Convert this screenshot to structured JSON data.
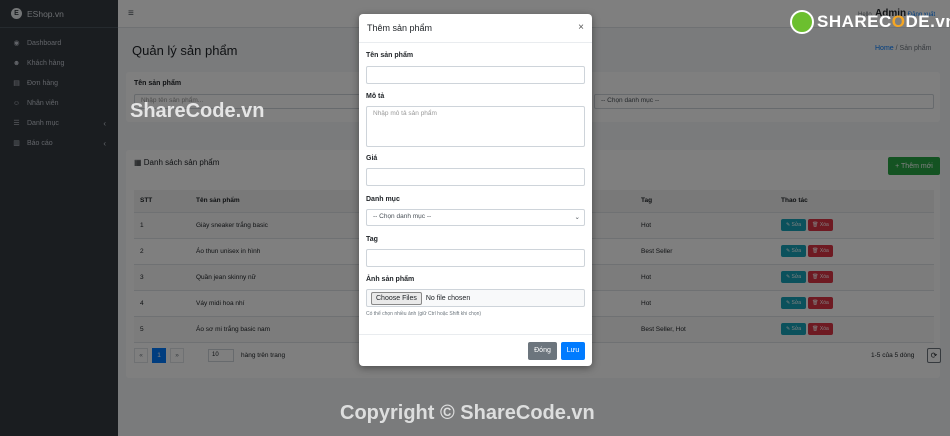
{
  "app": {
    "brand": "EShop.vn",
    "brand_logo": "E"
  },
  "sidebar": {
    "items": [
      {
        "label": "Dashboard",
        "icon": "dashboard-icon",
        "glyph": "◉",
        "chevron": ""
      },
      {
        "label": "Khách hàng",
        "icon": "users-icon",
        "glyph": "☻",
        "chevron": ""
      },
      {
        "label": "Đơn hàng",
        "icon": "file-icon",
        "glyph": "▤",
        "chevron": ""
      },
      {
        "label": "Nhân viên",
        "icon": "user-icon",
        "glyph": "☺",
        "chevron": ""
      },
      {
        "label": "Danh mục",
        "icon": "list-icon",
        "glyph": "☰",
        "chevron": "‹"
      },
      {
        "label": "Báo cáo",
        "icon": "chart-icon",
        "glyph": "▥",
        "chevron": "‹"
      }
    ]
  },
  "topbar": {
    "burger": "≡",
    "greeting": "Hello,",
    "user": "Admin",
    "logout": "Đăng xuất"
  },
  "page": {
    "title": "Quản lý sản phẩm",
    "breadcrumb_home": "Home",
    "breadcrumb_sep": "/",
    "breadcrumb_current": "Sản phẩm"
  },
  "filter": {
    "name_label": "Tên sản phẩm",
    "name_placeholder": "Nhập tên sản phẩm...",
    "category_value": "-- Chọn danh mục --"
  },
  "list": {
    "heading": "Danh sách sản phẩm",
    "add_button": "+ Thêm mới",
    "columns": [
      "STT",
      "Tên sản phẩm",
      "Tag",
      "Thao tác"
    ],
    "rows": [
      {
        "stt": "1",
        "name": "Giày sneaker trắng basic",
        "tag": "Hot"
      },
      {
        "stt": "2",
        "name": "Áo thun unisex in hình",
        "tag": "Best Seller"
      },
      {
        "stt": "3",
        "name": "Quần jean skinny nữ",
        "tag": "Hot"
      },
      {
        "stt": "4",
        "name": "Váy midi hoa nhí",
        "tag": "Hot"
      },
      {
        "stt": "5",
        "name": "Áo sơ mi trắng basic nam",
        "tag": "Best Seller, Hot"
      }
    ],
    "edit_label": "✎ Sửa",
    "delete_label": "🗑 Xóa",
    "pager_prev": "«",
    "pager_page": "1",
    "pager_next": "»",
    "per_page": "10",
    "per_page_label": "hàng trên trang",
    "summary": "1-5 của 5 dòng",
    "refresh": "⟳"
  },
  "modal": {
    "title": "Thêm sản phẩm",
    "close": "×",
    "name_label": "Tên sản phẩm",
    "desc_label": "Mô tả",
    "desc_placeholder": "Nhập mô tả sản phẩm",
    "price_label": "Giá",
    "category_label": "Danh mục",
    "category_value": "-- Chọn danh mục --",
    "tag_label": "Tag",
    "image_label": "Ảnh sản phẩm",
    "file_button": "Choose Files",
    "file_status": "No file chosen",
    "hint": "Có thể chọn nhiều ảnh (giữ Ctrl hoặc Shift khi chọn)",
    "close_button": "Đóng",
    "save_button": "Lưu"
  },
  "watermarks": {
    "logo_text_a": "SHAREC",
    "logo_text_o": "O",
    "logo_text_b": "DE.vn",
    "middle": "ShareCode.vn",
    "bottom": "Copyright © ShareCode.vn"
  }
}
